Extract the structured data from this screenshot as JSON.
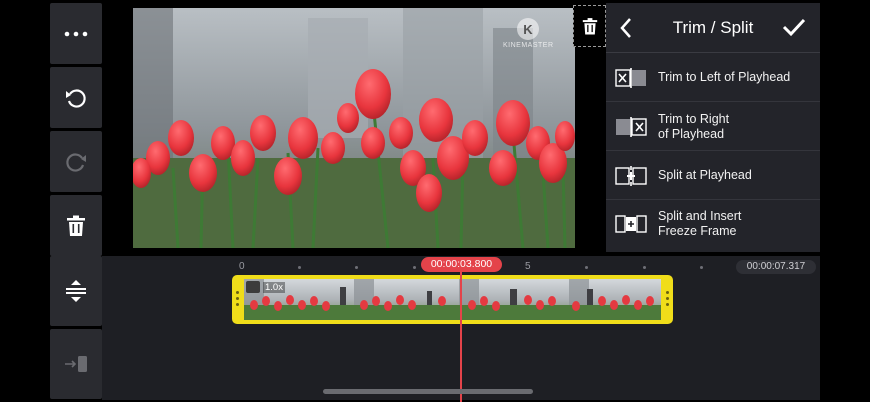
{
  "toolbar": {
    "more_icon": "more-horizontal-icon",
    "undo_icon": "undo-icon",
    "redo_icon": "redo-icon",
    "delete_icon": "trash-icon"
  },
  "preview": {
    "watermark": "KINEMASTER",
    "watermark_glyph": "K"
  },
  "panel": {
    "title": "Trim / Split",
    "back_icon": "chevron-left-icon",
    "confirm_icon": "checkmark-icon",
    "options": [
      {
        "label": "Trim to Left of Playhead",
        "icon": "trim-left-icon"
      },
      {
        "label": "Trim to Right\nof Playhead",
        "icon": "trim-right-icon"
      },
      {
        "label": "Split at Playhead",
        "icon": "split-icon"
      },
      {
        "label": "Split and Insert\nFreeze Frame",
        "icon": "split-freeze-icon"
      }
    ]
  },
  "timeline": {
    "ruler": [
      "0",
      "5"
    ],
    "current_time": "00:00:03.800",
    "end_time": "00:00:07.317",
    "clip_speed": "1.0x",
    "expand_icon": "expand-tracks-icon",
    "jump_icon": "jump-to-end-icon"
  },
  "colors": {
    "accent": "#e4434a",
    "clip_border": "#f0dd1a",
    "panel_bg": "#23242a",
    "toolbar_bg": "#2a2b30"
  }
}
